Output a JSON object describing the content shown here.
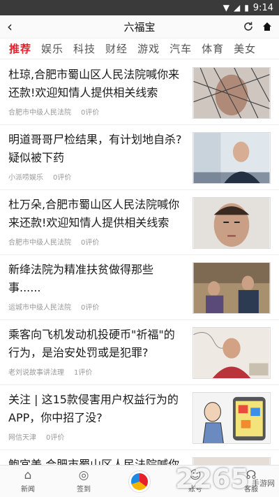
{
  "status": {
    "time": "9:14"
  },
  "header": {
    "title": "六福宝"
  },
  "tabs": [
    "推荐",
    "娱乐",
    "科技",
    "财经",
    "游戏",
    "汽车",
    "体育",
    "美女"
  ],
  "feed": [
    {
      "headline": "杜琼,合肥市蜀山区人民法院喊你来还款!欢迎知情人提供相关线索",
      "source": "合肥市中级人民法院",
      "comments": "0评价"
    },
    {
      "headline": "明道哥哥尸检结果，有计划地自杀?疑似被下药",
      "source": "小派唠娱乐",
      "comments": "0评价"
    },
    {
      "headline": "杜万朵,合肥市蜀山区人民法院喊你来还款!欢迎知情人提供相关线索",
      "source": "合肥市中级人民法院",
      "comments": "0评价"
    },
    {
      "headline": "新绛法院为精准扶贫做得那些事......",
      "source": "运城市中级人民法院",
      "comments": "0评价"
    },
    {
      "headline": "乘客向飞机发动机投硬币\"祈福\"的行为，是治安处罚或是犯罪?",
      "source": "老刘说故事讲法理",
      "comments": "1评价"
    },
    {
      "headline": "关注 | 这15款侵害用户权益行为的APP，你中招了没?",
      "source": "网信天津",
      "comments": "0评价"
    },
    {
      "headline": "鲍宜美,合肥市蜀山区人民法院喊你",
      "source": "",
      "comments": ""
    }
  ],
  "bottom_nav": {
    "news": "新闻",
    "checkin": "签到",
    "account": "账号",
    "service": "客服"
  },
  "watermark": {
    "main": "2265",
    "sub": "手游网"
  },
  "colors": {
    "accent": "#e6212a"
  }
}
